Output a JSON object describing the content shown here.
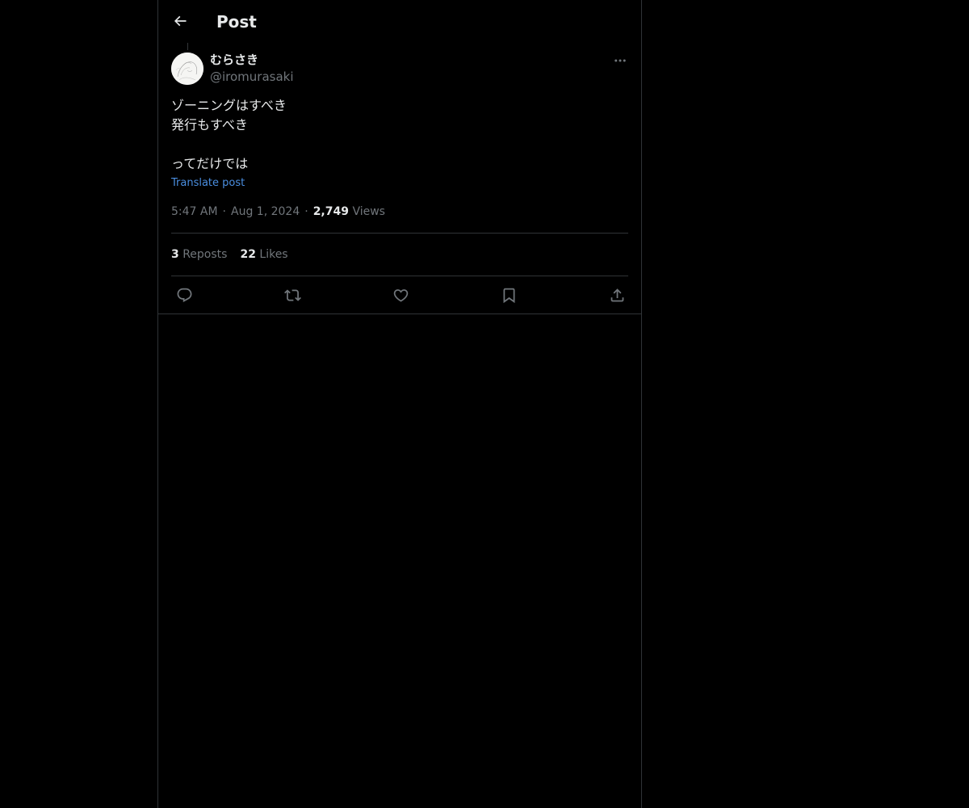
{
  "header": {
    "title": "Post",
    "back_icon": "arrow-left-icon"
  },
  "post": {
    "author": {
      "display_name": "むらさき",
      "handle": "@iromurasaki"
    },
    "text_lines": [
      "ゾーニングはすべき",
      "発行もすべき",
      "",
      "ってだけでは"
    ],
    "translate_label": "Translate post",
    "time": "5:47 AM",
    "date": "Aug 1, 2024",
    "views_count": "2,749",
    "views_label": "Views",
    "separator": "·",
    "reposts_count": "3",
    "reposts_label": "Reposts",
    "likes_count": "22",
    "likes_label": "Likes"
  },
  "actions": [
    {
      "name": "reply",
      "icon": "speech-bubble-icon"
    },
    {
      "name": "repost",
      "icon": "repost-arrows-icon"
    },
    {
      "name": "like",
      "icon": "heart-icon"
    },
    {
      "name": "bookmark",
      "icon": "bookmark-icon"
    },
    {
      "name": "share",
      "icon": "share-upload-icon"
    }
  ],
  "colors": {
    "background": "#000000",
    "text_primary": "#e7e9ea",
    "text_secondary": "#71767b",
    "link": "#4a8ee0",
    "border": "#2f3336"
  }
}
